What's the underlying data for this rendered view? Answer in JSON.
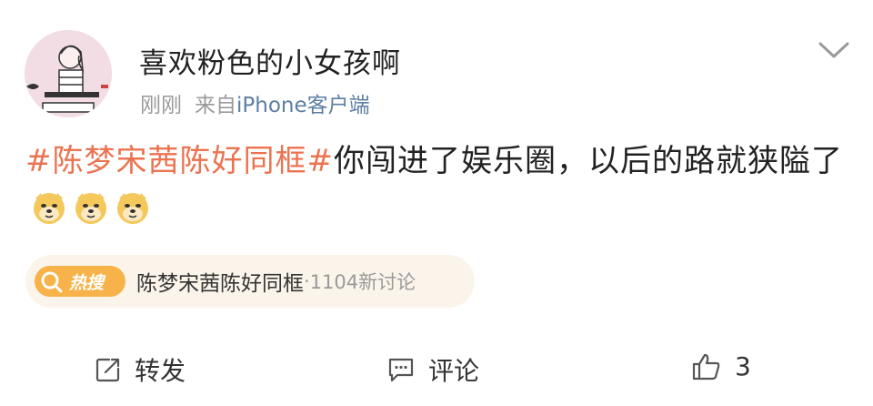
{
  "post": {
    "username": "喜欢粉色的小女孩啊",
    "time": "刚刚",
    "source_prefix": "来自",
    "source": "iPhone客户端",
    "topic": "#陈梦宋茜陈好同框#",
    "text": "你闯进了娱乐圈，以后的路就狭隘了",
    "emojis": [
      "doge-emoji",
      "doge-emoji",
      "doge-emoji"
    ]
  },
  "hot_topic": {
    "badge": "热搜",
    "title": "陈梦宋茜陈好同框",
    "separator": "·",
    "count": "1104新讨论"
  },
  "actions": {
    "repost_label": "转发",
    "comment_label": "评论",
    "like_count": "3"
  },
  "colors": {
    "topic": "#eb7350",
    "source": "#5d7fa3",
    "badge": "#f7b34a",
    "card_bg": "#fbf4ea"
  }
}
